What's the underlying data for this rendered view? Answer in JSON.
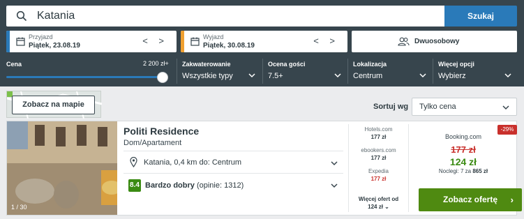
{
  "search": {
    "value": "Katania",
    "button": "Szukaj"
  },
  "dates": {
    "checkin": {
      "label": "Przyjazd",
      "value": "Piątek, 23.08.19"
    },
    "checkout": {
      "label": "Wyjazd",
      "value": "Piątek, 30.08.19"
    },
    "arrows": "< >"
  },
  "room": {
    "label": "Dwuosobowy"
  },
  "filters": {
    "price": {
      "label": "Cena",
      "max": "2 200 zł+",
      "level": 1.0
    },
    "lodging": {
      "label": "Zakwaterowanie",
      "value": "Wszystkie typy"
    },
    "guest_rating": {
      "label": "Ocena gości",
      "value": "7.5+"
    },
    "location": {
      "label": "Lokalizacja",
      "value": "Centrum"
    },
    "more": {
      "label": "Więcej opcji",
      "value": "Wybierz"
    }
  },
  "map": {
    "button": "Zobacz na mapie"
  },
  "sort": {
    "label": "Sortuj wg",
    "value": "Tylko cena"
  },
  "hotel": {
    "name": "Politi Residence",
    "type": "Dom/Apartament",
    "location": "Katania, 0,4 km do: Centrum",
    "rating_score": "8.4",
    "rating_text": "Bardzo dobry",
    "rating_count": "(opinie: 1312)",
    "photo_count": "1 / 30",
    "deals": [
      {
        "site": "Hotels.com",
        "price": "177 zł"
      },
      {
        "site": "ebookers.com",
        "price": "177 zł"
      },
      {
        "site": "Expedia",
        "price": "177 zł"
      }
    ],
    "more_offers": "Więcej ofert od",
    "more_price": "124 zł ⌄",
    "best": {
      "discount": "-29%",
      "site": "Booking.com",
      "old_price": "177 zł",
      "new_price": "124 zł",
      "nights_text": "Noclegi: 7 za",
      "nights_total": "865 zł",
      "button": "Zobacz ofertę",
      "button_arrow": "›"
    }
  },
  "colors": {
    "header": "#37454d",
    "accent": "#2a7ab9",
    "checkin_bar": "#2a7ab9",
    "checkout_bar": "#f0a030",
    "deal_green": "#4f8a11",
    "discount_red": "#c9302c"
  }
}
